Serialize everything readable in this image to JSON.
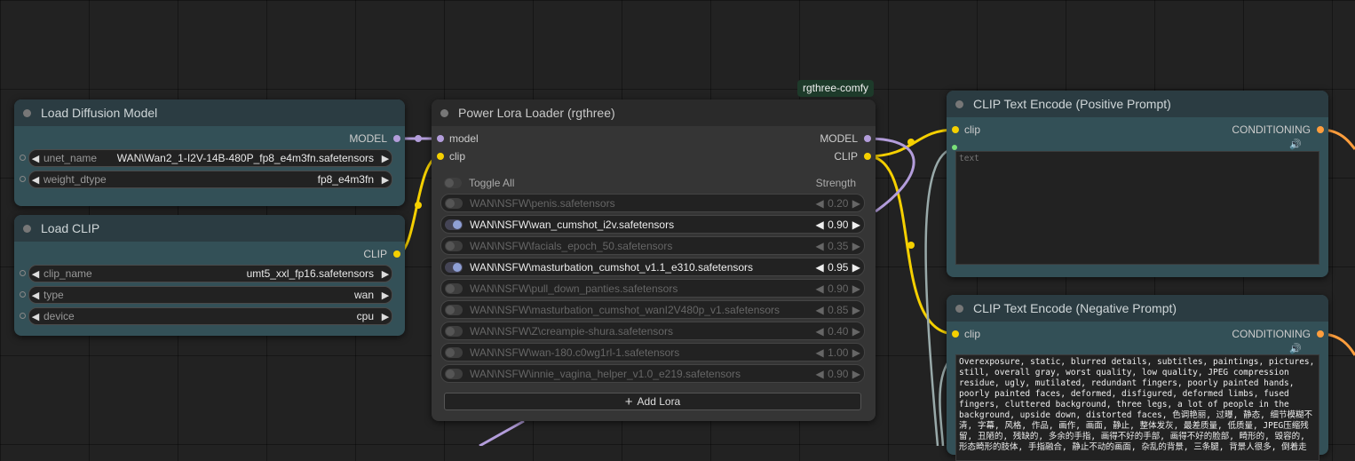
{
  "badge": "rgthree-comfy",
  "load_diffusion": {
    "title": "Load Diffusion Model",
    "output": "MODEL",
    "unet_label": "unet_name",
    "unet_value": "WAN\\Wan2_1-I2V-14B-480P_fp8_e4m3fn.safetensors",
    "dtype_label": "weight_dtype",
    "dtype_value": "fp8_e4m3fn"
  },
  "load_clip": {
    "title": "Load CLIP",
    "output": "CLIP",
    "clip_label": "clip_name",
    "clip_value": "umt5_xxl_fp16.safetensors",
    "type_label": "type",
    "type_value": "wan",
    "device_label": "device",
    "device_value": "cpu"
  },
  "lora_loader": {
    "title": "Power Lora Loader (rgthree)",
    "in_model": "model",
    "in_clip": "clip",
    "out_model": "MODEL",
    "out_clip": "CLIP",
    "toggle_all": "Toggle All",
    "strength_header": "Strength",
    "add_lora": "Add Lora",
    "loras": [
      {
        "name": "WAN\\NSFW\\penis.safetensors",
        "strength": "0.20",
        "on": false
      },
      {
        "name": "WAN\\NSFW\\wan_cumshot_i2v.safetensors",
        "strength": "0.90",
        "on": true
      },
      {
        "name": "WAN\\NSFW\\facials_epoch_50.safetensors",
        "strength": "0.35",
        "on": false
      },
      {
        "name": "WAN\\NSFW\\masturbation_cumshot_v1.1_e310.safetensors",
        "strength": "0.95",
        "on": true
      },
      {
        "name": "WAN\\NSFW\\pull_down_panties.safetensors",
        "strength": "0.90",
        "on": false
      },
      {
        "name": "WAN\\NSFW\\masturbation_cumshot_wanI2V480p_v1.safetensors",
        "strength": "0.85",
        "on": false
      },
      {
        "name": "WAN\\NSFW\\Z\\creampie-shura.safetensors",
        "strength": "0.40",
        "on": false
      },
      {
        "name": "WAN\\NSFW\\wan-180.c0wg1rl-1.safetensors",
        "strength": "1.00",
        "on": false
      },
      {
        "name": "WAN\\NSFW\\innie_vagina_helper_v1.0_e219.safetensors",
        "strength": "0.90",
        "on": false
      }
    ]
  },
  "positive": {
    "title": "CLIP Text Encode (Positive Prompt)",
    "in_clip": "clip",
    "output": "CONDITIONING",
    "placeholder": "text"
  },
  "negative": {
    "title": "CLIP Text Encode (Negative Prompt)",
    "in_clip": "clip",
    "output": "CONDITIONING",
    "text": "Overexposure, static, blurred details, subtitles, paintings, pictures, still, overall gray, worst quality, low quality, JPEG compression residue, ugly, mutilated, redundant fingers, poorly painted hands, poorly painted faces, deformed, disfigured, deformed limbs, fused fingers, cluttered background, three legs, a lot of people in the background, upside down, distorted faces, 色调艳丽, 过曝, 静态, 细节模糊不清, 字幕, 风格, 作品, 画作, 画面, 静止, 整体发灰, 最差质量, 低质量, JPEG压缩残留, 丑陋的, 残缺的, 多余的手指, 画得不好的手部, 画得不好的脸部, 畸形的, 毁容的, 形态畸形的肢体, 手指融合, 静止不动的画面, 杂乱的背景, 三条腿, 背景人很多, 倒着走"
  }
}
